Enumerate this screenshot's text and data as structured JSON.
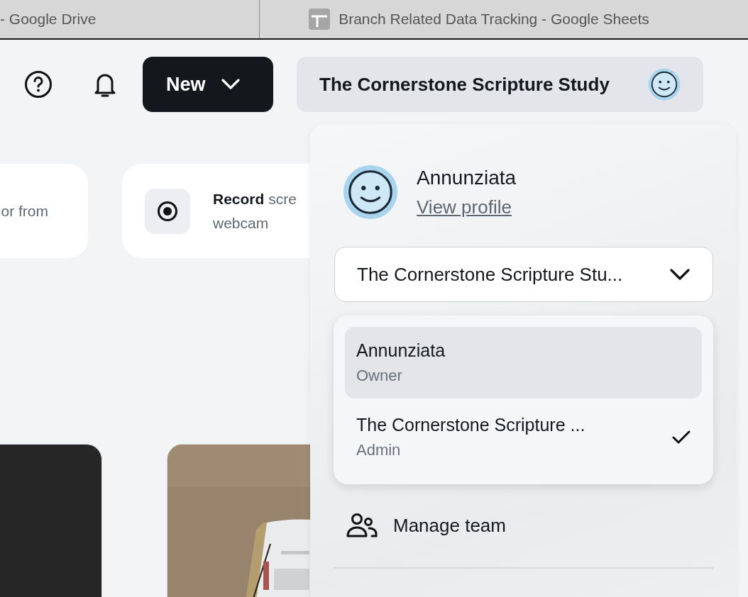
{
  "browser_tabs": [
    {
      "title": "- Google Drive",
      "kind": "plain"
    },
    {
      "title": "Branch Related Data Tracking - Google Sheets",
      "kind": "sheets"
    }
  ],
  "header": {
    "new_button": "New",
    "team_button": "The Cornerstone Scripture Study"
  },
  "action_cards": [
    {
      "text": "or from",
      "kind": "plain"
    },
    {
      "text": "**Record** scre\nwebcam",
      "kind": "record"
    }
  ],
  "thumbnails": [
    {
      "kind": "dark"
    },
    {
      "kind": "picture"
    }
  ],
  "account_menu": {
    "name": "Annunziata",
    "profile_link": "View profile",
    "team_select": "The Cornerstone Scripture Stu...",
    "team_options": [
      {
        "name": "Annunziata",
        "role": "Owner",
        "highlighted": true,
        "checked": false
      },
      {
        "name": "The Cornerstone Scripture ...",
        "role": "Admin",
        "highlighted": false,
        "checked": true
      }
    ],
    "items": [
      {
        "label": "Manage team",
        "kind": "team"
      }
    ]
  }
}
